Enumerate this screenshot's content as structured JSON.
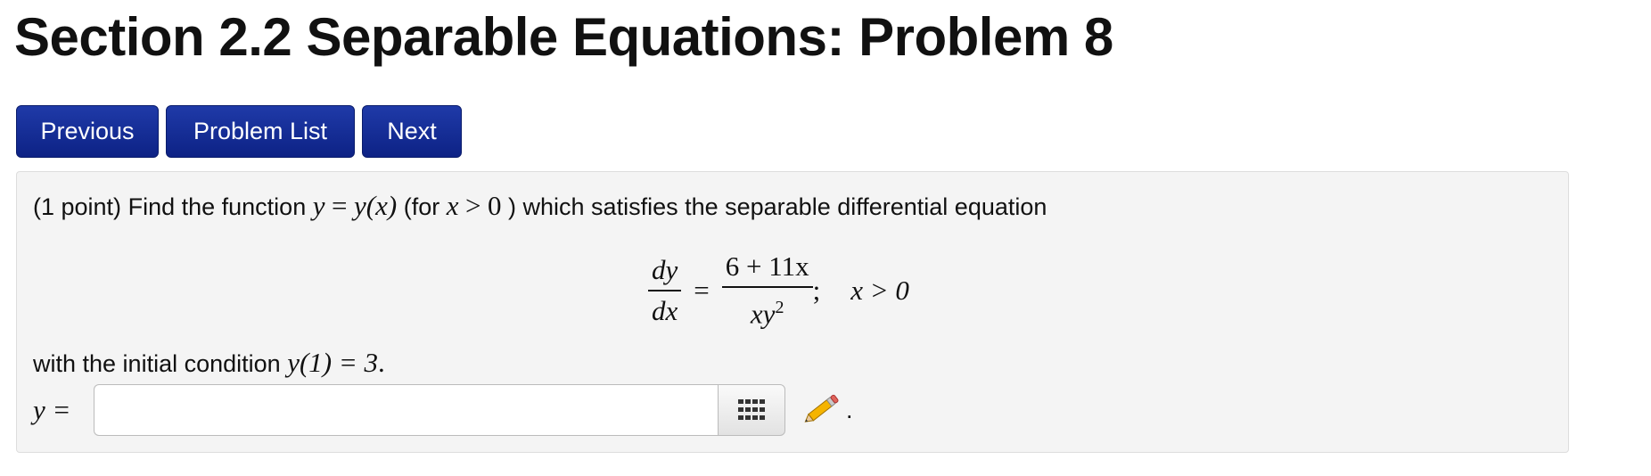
{
  "page": {
    "title": "Section 2.2 Separable Equations: Problem 8"
  },
  "nav": {
    "previous_label": "Previous",
    "problem_list_label": "Problem List",
    "next_label": "Next"
  },
  "problem": {
    "points": "(1 point)",
    "intro_a": "Find the function",
    "fn_y": "y",
    "fn_eq": "=",
    "fn_rhs": "y(x)",
    "paren_open": "(for",
    "cond_x": "x",
    "cond_gt": ">",
    "cond_zero": "0",
    "paren_close": ")",
    "intro_b": "which satisfies the separable differential equation",
    "equation": {
      "lhs_num": "dy",
      "lhs_den": "dx",
      "equals": "=",
      "rhs_num": "6 + 11x",
      "rhs_den_base": "xy",
      "rhs_den_exp": "2",
      "semicolon": ";",
      "condition": "x > 0"
    },
    "initial_text": "with the initial condition",
    "initial_math": "y(1) = 3",
    "initial_period": ".",
    "answer_label": "y =",
    "answer_value": "",
    "answer_tail": "."
  },
  "icons": {
    "keyboard": "keypad-icon",
    "edit": "pencil-icon"
  }
}
